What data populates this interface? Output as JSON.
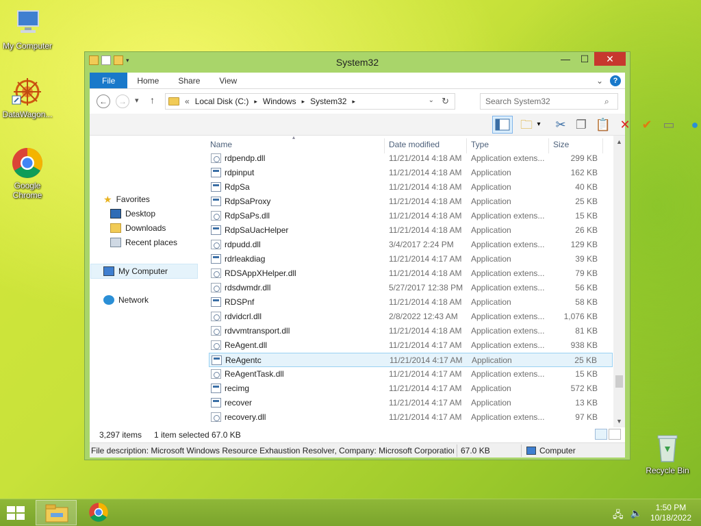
{
  "desktop": {
    "icons": [
      {
        "label": "My Computer"
      },
      {
        "label": "DataWagon..."
      },
      {
        "label": "Google Chrome"
      },
      {
        "label": "Recycle Bin"
      }
    ]
  },
  "window": {
    "title": "System32",
    "minimize": "—",
    "maximize": "☐",
    "close": "✕"
  },
  "ribbon": {
    "tabs": [
      "File",
      "Home",
      "Share",
      "View"
    ],
    "collapse": "⌄",
    "help": "?"
  },
  "address": {
    "back": "←",
    "forward": "→",
    "recent": "▾",
    "up": "↑",
    "overflow": "«",
    "crumbs": [
      "Local Disk (C:)",
      "Windows",
      "System32"
    ],
    "refresh": "↻",
    "search_placeholder": "Search System32"
  },
  "nav": {
    "favorites": "Favorites",
    "desktop": "Desktop",
    "downloads": "Downloads",
    "recent": "Recent places",
    "computer": "My Computer",
    "network": "Network"
  },
  "columns": {
    "name": "Name",
    "date": "Date modified",
    "type": "Type",
    "size": "Size"
  },
  "files": [
    {
      "name": "rdpendp.dll",
      "date": "11/21/2014 4:18 AM",
      "type": "Application extens...",
      "size": "299 KB",
      "kind": "dll"
    },
    {
      "name": "rdpinput",
      "date": "11/21/2014 4:18 AM",
      "type": "Application",
      "size": "162 KB",
      "kind": "app"
    },
    {
      "name": "RdpSa",
      "date": "11/21/2014 4:18 AM",
      "type": "Application",
      "size": "40 KB",
      "kind": "app"
    },
    {
      "name": "RdpSaProxy",
      "date": "11/21/2014 4:18 AM",
      "type": "Application",
      "size": "25 KB",
      "kind": "app"
    },
    {
      "name": "RdpSaPs.dll",
      "date": "11/21/2014 4:18 AM",
      "type": "Application extens...",
      "size": "15 KB",
      "kind": "dll"
    },
    {
      "name": "RdpSaUacHelper",
      "date": "11/21/2014 4:18 AM",
      "type": "Application",
      "size": "26 KB",
      "kind": "app"
    },
    {
      "name": "rdpudd.dll",
      "date": "3/4/2017 2:24 PM",
      "type": "Application extens...",
      "size": "129 KB",
      "kind": "dll"
    },
    {
      "name": "rdrleakdiag",
      "date": "11/21/2014 4:17 AM",
      "type": "Application",
      "size": "39 KB",
      "kind": "app"
    },
    {
      "name": "RDSAppXHelper.dll",
      "date": "11/21/2014 4:18 AM",
      "type": "Application extens...",
      "size": "79 KB",
      "kind": "dll"
    },
    {
      "name": "rdsdwmdr.dll",
      "date": "5/27/2017 12:38 PM",
      "type": "Application extens...",
      "size": "56 KB",
      "kind": "dll"
    },
    {
      "name": "RDSPnf",
      "date": "11/21/2014 4:18 AM",
      "type": "Application",
      "size": "58 KB",
      "kind": "app"
    },
    {
      "name": "rdvidcrl.dll",
      "date": "2/8/2022 12:43 AM",
      "type": "Application extens...",
      "size": "1,076 KB",
      "kind": "dll"
    },
    {
      "name": "rdvvmtransport.dll",
      "date": "11/21/2014 4:18 AM",
      "type": "Application extens...",
      "size": "81 KB",
      "kind": "dll"
    },
    {
      "name": "ReAgent.dll",
      "date": "11/21/2014 4:17 AM",
      "type": "Application extens...",
      "size": "938 KB",
      "kind": "dll"
    },
    {
      "name": "ReAgentc",
      "date": "11/21/2014 4:17 AM",
      "type": "Application",
      "size": "25 KB",
      "kind": "app",
      "selected": true
    },
    {
      "name": "ReAgentTask.dll",
      "date": "11/21/2014 4:17 AM",
      "type": "Application extens...",
      "size": "15 KB",
      "kind": "dll"
    },
    {
      "name": "recimg",
      "date": "11/21/2014 4:17 AM",
      "type": "Application",
      "size": "572 KB",
      "kind": "app"
    },
    {
      "name": "recover",
      "date": "11/21/2014 4:17 AM",
      "type": "Application",
      "size": "13 KB",
      "kind": "app"
    },
    {
      "name": "recovery.dll",
      "date": "11/21/2014 4:17 AM",
      "type": "Application extens...",
      "size": "97 KB",
      "kind": "dll"
    }
  ],
  "status": {
    "items": "3,297 items",
    "selected": "1 item selected  67.0 KB"
  },
  "details": {
    "description": "File description: Microsoft Windows Resource Exhaustion Resolver, Company: Microsoft Corporation, F",
    "size": "67.0 KB",
    "location": "Computer"
  },
  "taskbar": {
    "time": "1:50 PM",
    "date": "10/18/2022"
  }
}
